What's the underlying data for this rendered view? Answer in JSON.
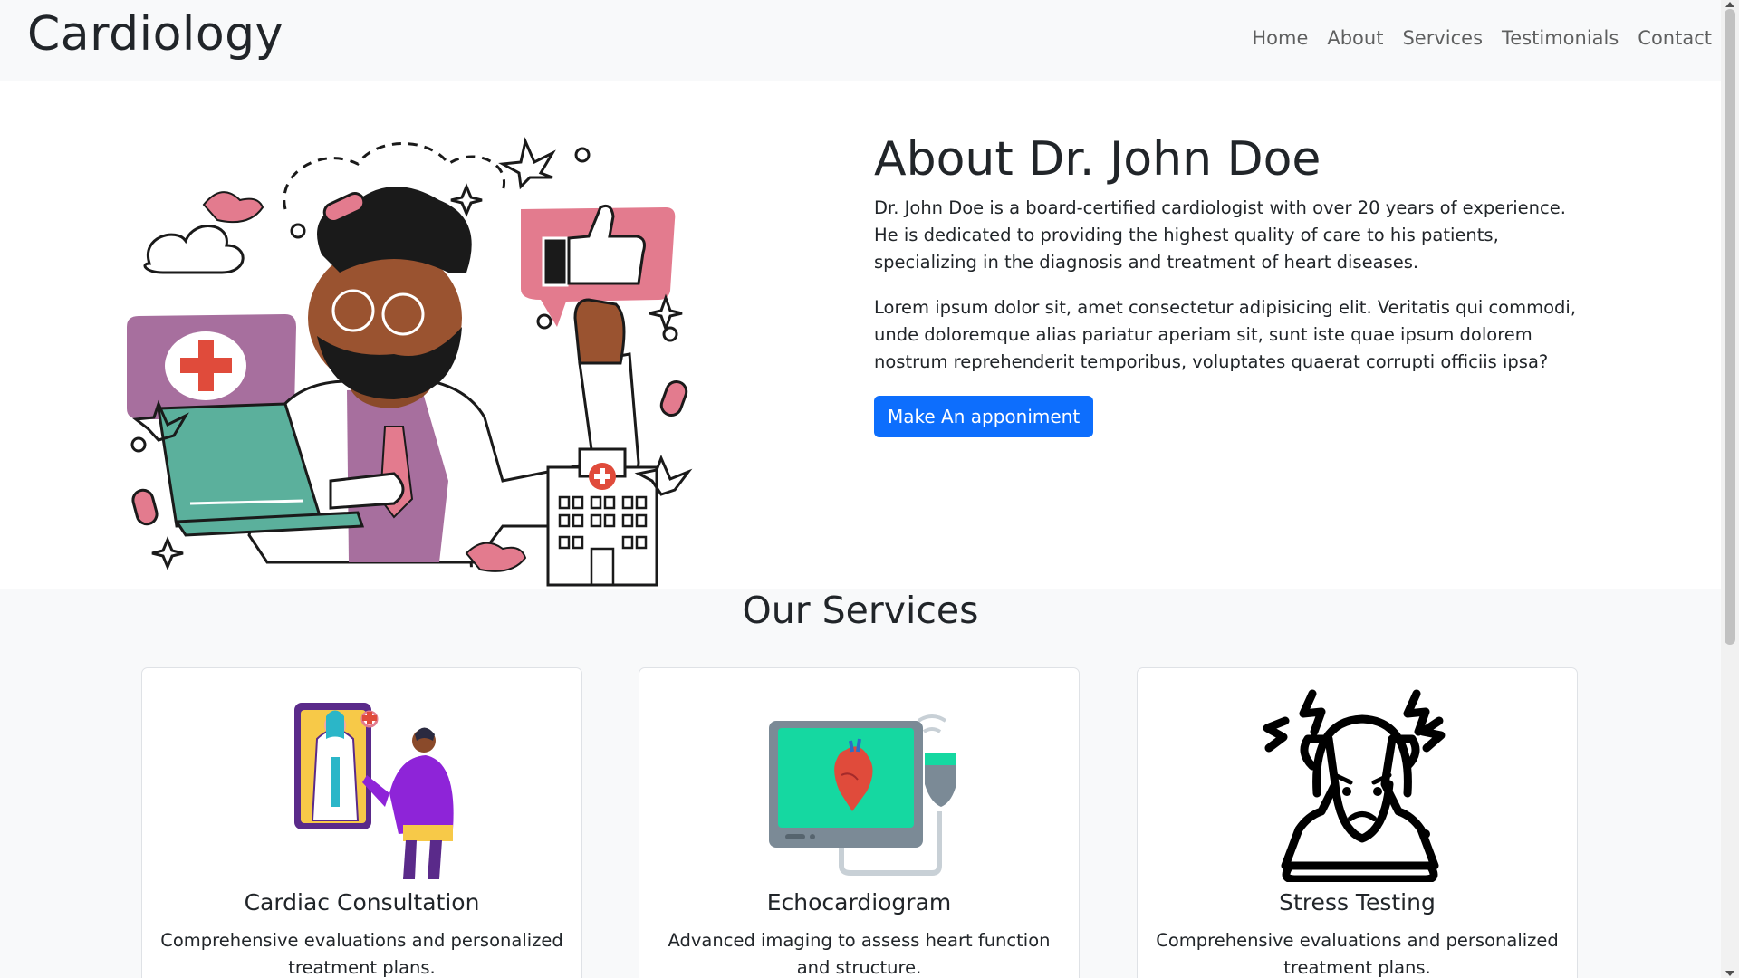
{
  "navbar": {
    "brand": "Cardiology",
    "links": [
      "Home",
      "About",
      "Services",
      "Testimonials",
      "Contact"
    ]
  },
  "about": {
    "title": "About Dr. John Doe",
    "paragraph1": "Dr. John Doe is a board-certified cardiologist with over 20 years of experience. He is dedicated to providing the highest quality of care to his patients, specializing in the diagnosis and treatment of heart diseases.",
    "paragraph2": "Lorem ipsum dolor sit, amet consectetur adipisicing elit. Veritatis qui commodi, unde doloremque alias pariatur aperiam sit, sunt iste quae ipsum dolorem nostrum reprehenderit temporibus, voluptates quaerat corrupti officiis ipsa?",
    "button_label": "Make An apponiment"
  },
  "services": {
    "title": "Our Services",
    "cards": [
      {
        "title": "Cardiac Consultation",
        "text": "Comprehensive evaluations and personalized treatment plans.",
        "icon": "doctor-consultation-icon"
      },
      {
        "title": "Echocardiogram",
        "text": "Advanced imaging to assess heart function and structure.",
        "icon": "echocardiogram-monitor-icon"
      },
      {
        "title": "Stress Testing",
        "text": "Comprehensive evaluations and personalized treatment plans.",
        "icon": "stressed-person-icon"
      }
    ]
  },
  "colors": {
    "primary": "#0d6efd",
    "navbar_bg": "#f8f9fa",
    "text": "#212529"
  }
}
